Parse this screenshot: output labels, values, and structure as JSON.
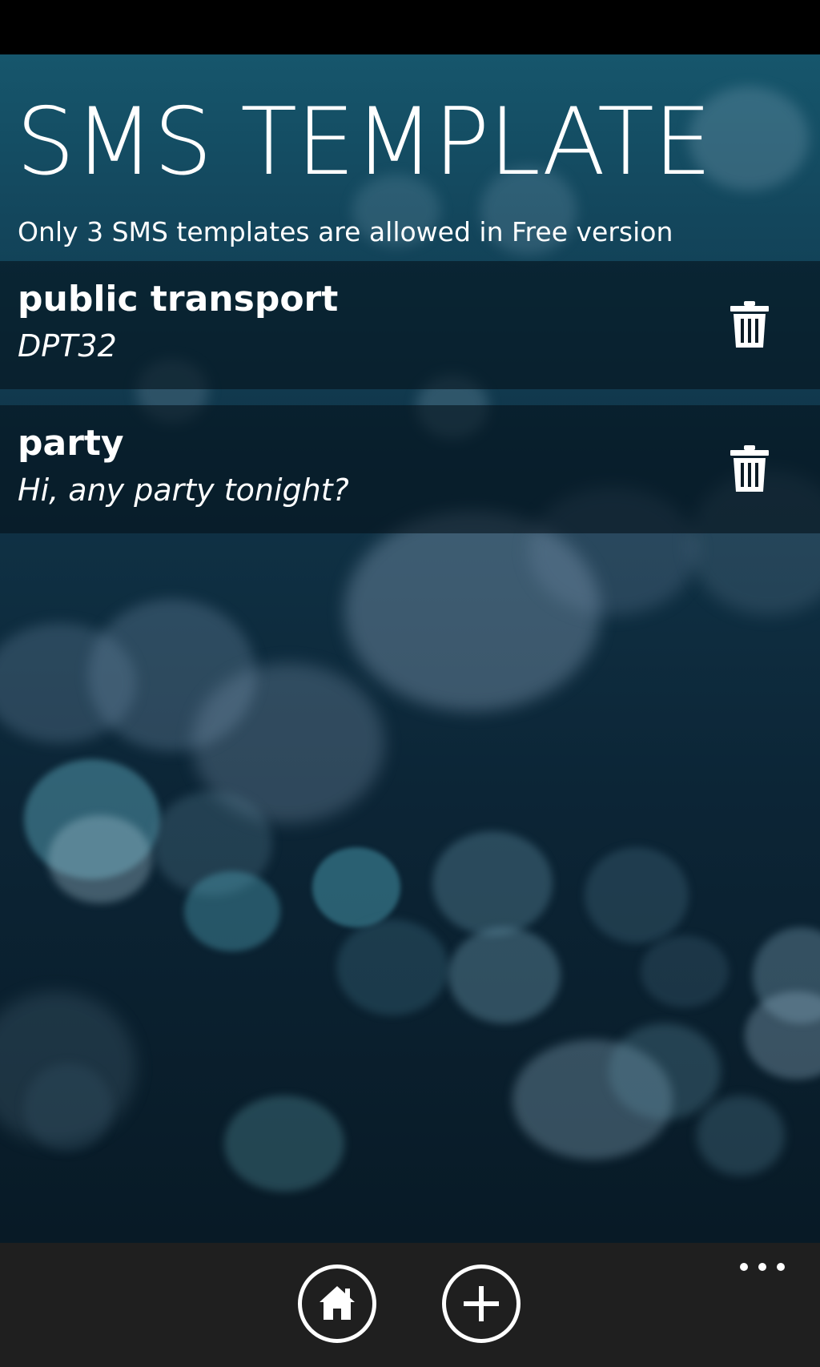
{
  "page": {
    "title": "SMS TEMPLATE",
    "subtitle": "Only 3 SMS templates are allowed in Free version"
  },
  "templates": [
    {
      "name": "public transport",
      "body": "DPT32",
      "delete_icon": "trash-icon"
    },
    {
      "name": "party",
      "body": "Hi, any party tonight?",
      "delete_icon": "trash-icon"
    }
  ],
  "app_bar": {
    "buttons": [
      {
        "icon": "home-icon"
      },
      {
        "icon": "add-icon"
      }
    ],
    "more_icon": "ellipsis-icon"
  },
  "colors": {
    "background_top": "#16566c",
    "background_bottom": "#081a26",
    "app_bar": "#1f1f1f",
    "text": "#ffffff"
  }
}
